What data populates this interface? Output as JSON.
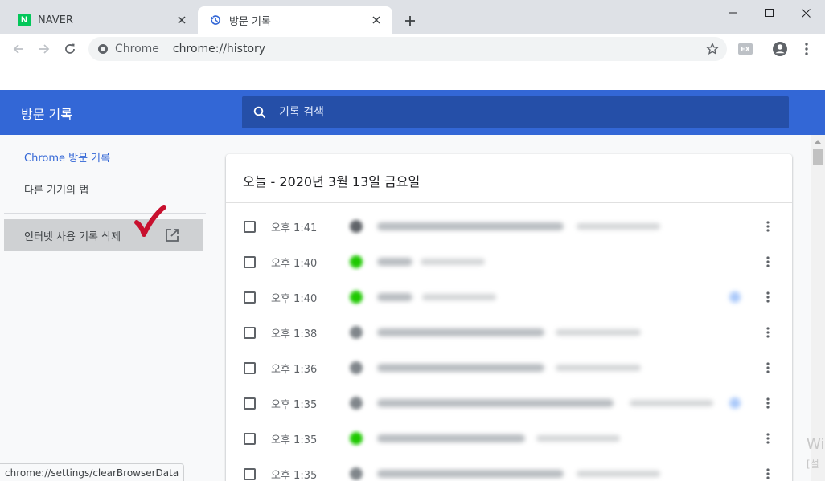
{
  "tabs": [
    {
      "title": "NAVER",
      "icon": "naver-icon",
      "active": false
    },
    {
      "title": "방문 기록",
      "icon": "history-icon",
      "active": true
    }
  ],
  "toolbar": {
    "omnibox_label": "Chrome",
    "url": "chrome://history",
    "ext_badge": "EX"
  },
  "header": {
    "title": "방문 기록",
    "search_placeholder": "기록 검색"
  },
  "sidebar": {
    "items": [
      {
        "label": "Chrome 방문 기록",
        "selected": true
      },
      {
        "label": "다른 기기의 탭",
        "selected": false
      },
      {
        "label": "인터넷 사용 기록 삭제",
        "selected": false,
        "external": true
      }
    ]
  },
  "history": {
    "date_heading": "오늘 - 2020년 3월 13일 금요일",
    "entries": [
      {
        "time": "오후 1:41"
      },
      {
        "time": "오후 1:40"
      },
      {
        "time": "오후 1:40"
      },
      {
        "time": "오후 1:38"
      },
      {
        "time": "오후 1:36"
      },
      {
        "time": "오후 1:35"
      },
      {
        "time": "오후 1:35"
      },
      {
        "time": "오후 1:35"
      }
    ]
  },
  "status_bar": {
    "url": "chrome://settings/clearBrowserData"
  },
  "watermark": {
    "line1": "Wi",
    "line2": "[설"
  },
  "colors": {
    "header_bg": "#3367d6",
    "search_bg": "#254fa8",
    "accent": "#3367d6",
    "checkmark": "#c8102e",
    "naver_green": "#03c75a"
  }
}
